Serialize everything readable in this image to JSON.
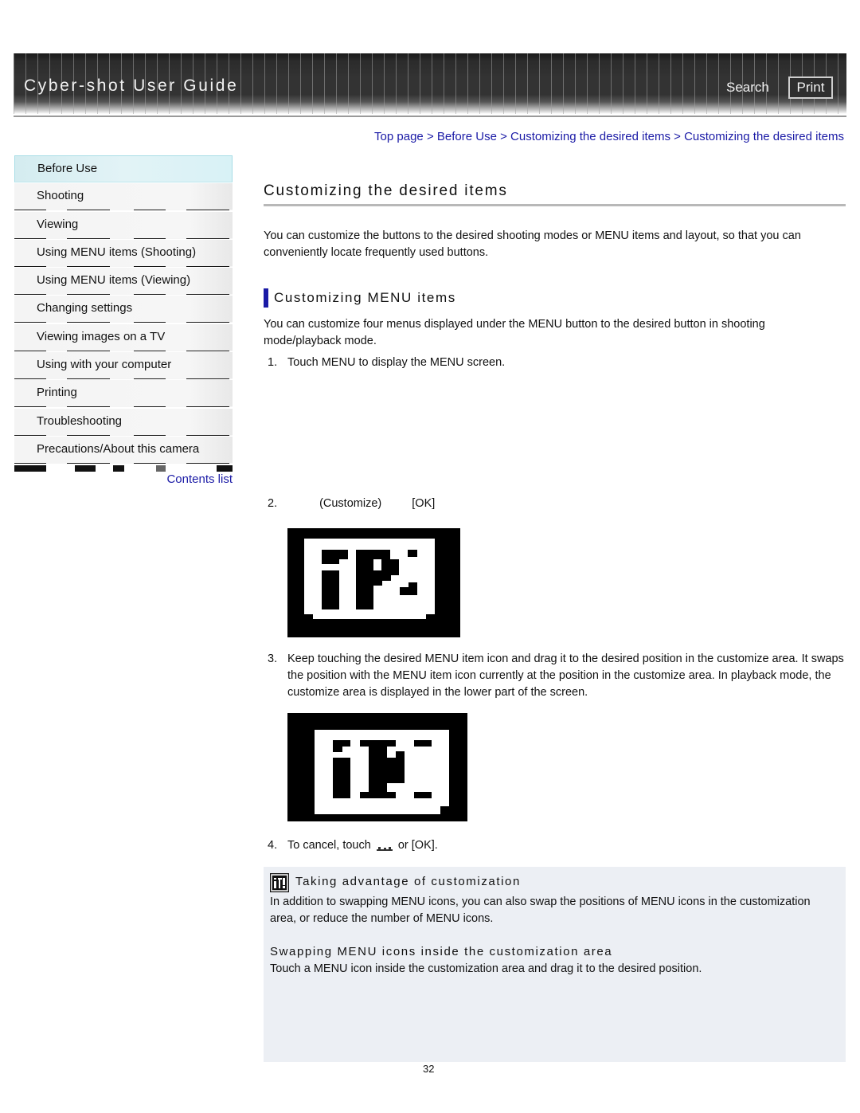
{
  "header": {
    "title": "Cyber-shot User Guide",
    "search_label": "Search",
    "print_label": "Print"
  },
  "breadcrumb": {
    "items": [
      "Top page",
      "Before Use",
      "Customizing the desired items",
      "Customizing the desired items"
    ],
    "separator": ">"
  },
  "sidebar": {
    "items": [
      {
        "label": "Before Use",
        "active": true
      },
      {
        "label": "Shooting"
      },
      {
        "label": "Viewing"
      },
      {
        "label": "Using MENU items (Shooting)"
      },
      {
        "label": "Using MENU items (Viewing)"
      },
      {
        "label": "Changing settings"
      },
      {
        "label": "Viewing images on a TV"
      },
      {
        "label": "Using with your computer"
      },
      {
        "label": "Printing"
      },
      {
        "label": "Troubleshooting"
      },
      {
        "label": "Precautions/About this camera"
      }
    ],
    "contents_link": "Contents list"
  },
  "main": {
    "title": "Customizing the desired items",
    "intro": "You can customize the buttons to the desired shooting modes or MENU items and layout, so that you can conveniently locate frequently used buttons.",
    "section": {
      "heading": "Customizing MENU items",
      "intro": "You can customize four menus displayed under the MENU button to the desired button in shooting mode/playback mode.",
      "steps": [
        {
          "num": "1.",
          "text": "Touch MENU to display the MENU screen."
        },
        {
          "num": "2.",
          "text_a": "(Customize)",
          "text_b": "[OK]"
        },
        {
          "num": "3.",
          "text": "Keep touching the desired MENU item icon and drag it to the desired position in the customize area. It swaps the position with the MENU item icon currently at the position in the customize area. In playback mode, the customize area is displayed in the lower part of the screen."
        },
        {
          "num": "4.",
          "text_a": "To cancel, touch",
          "icon": "cancel-icon",
          "text_b": "or [OK]."
        }
      ]
    }
  },
  "hint": {
    "icon": "hint-icon",
    "title": "Taking advantage of customization",
    "body": "In addition to swapping MENU icons, you can also swap the positions of MENU icons in the customization area, or reduce the number of MENU icons.",
    "subtitle": "Swapping MENU icons inside the customization area",
    "subbody": "Touch a MENU icon inside the customization area and drag it to the desired position."
  },
  "footer": {
    "page_number": "32"
  }
}
